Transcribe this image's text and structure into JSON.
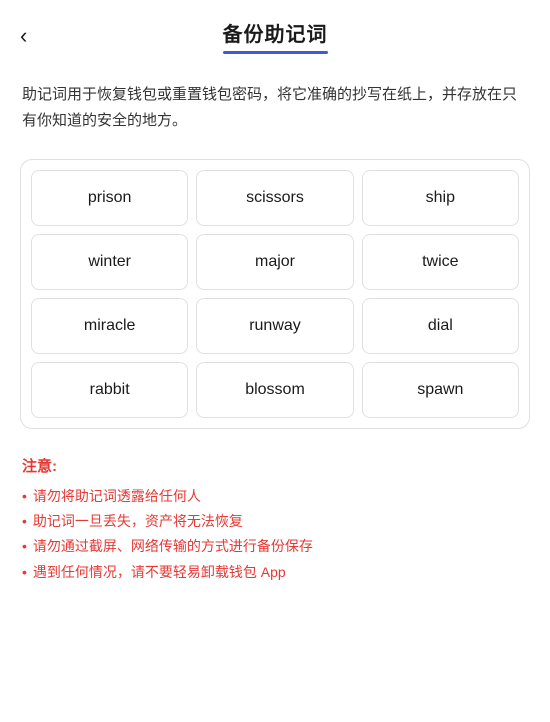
{
  "header": {
    "back_label": "‹",
    "title": "备份助记词",
    "underline_color": "#3b5bdb"
  },
  "description": {
    "text": "助记词用于恢复钱包或重置钱包密码，将它准确的抄写在纸上，并存放在只有你知道的安全的地方。"
  },
  "mnemonic": {
    "words": [
      "prison",
      "scissors",
      "ship",
      "winter",
      "major",
      "twice",
      "miracle",
      "runway",
      "dial",
      "rabbit",
      "blossom",
      "spawn"
    ]
  },
  "notice": {
    "title": "注意:",
    "items": [
      "请勿将助记词透露给任何人",
      "助记词一旦丢失，资产将无法恢复",
      "请勿通过截屏、网络传输的方式进行备份保存",
      "遇到任何情况，请不要轻易卸载钱包 App"
    ]
  }
}
